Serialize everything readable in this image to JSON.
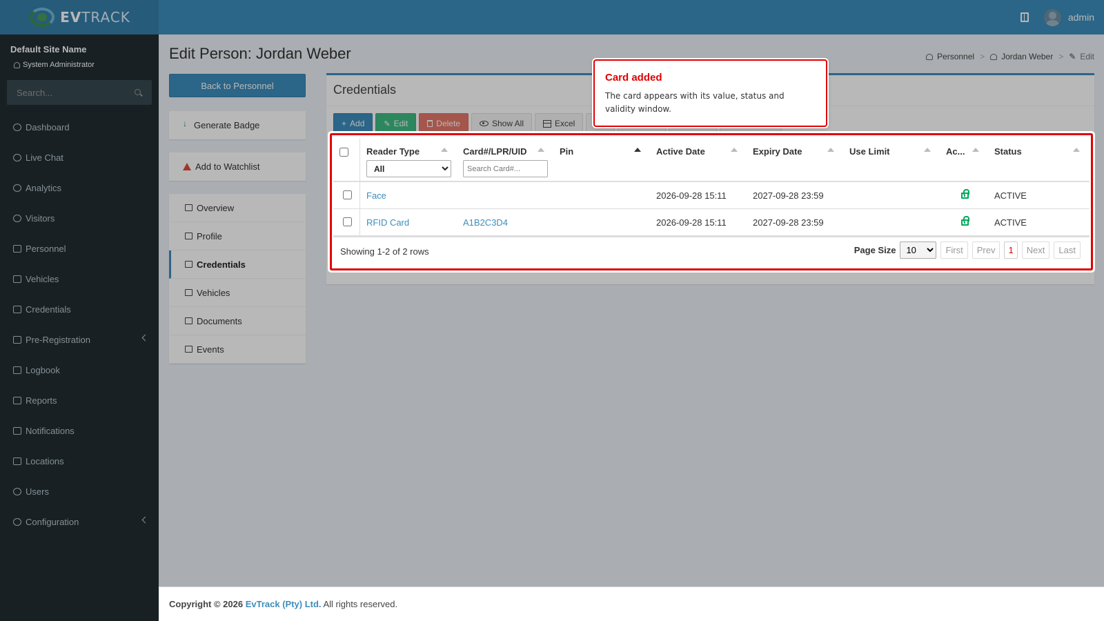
{
  "app": {
    "logo_bold": "EV",
    "logo_light": "TRACK",
    "username": "admin"
  },
  "sidebar": {
    "site_name": "Default Site Name",
    "role": "System Administrator",
    "search_placeholder": "Search...",
    "items": [
      {
        "label": "Dashboard"
      },
      {
        "label": "Live Chat"
      },
      {
        "label": "Analytics"
      },
      {
        "label": "Visitors"
      },
      {
        "label": "Personnel"
      },
      {
        "label": "Vehicles"
      },
      {
        "label": "Credentials"
      },
      {
        "label": "Pre-Registration"
      },
      {
        "label": "Logbook"
      },
      {
        "label": "Reports"
      },
      {
        "label": "Notifications"
      },
      {
        "label": "Locations"
      },
      {
        "label": "Users"
      },
      {
        "label": "Configuration"
      }
    ]
  },
  "page": {
    "title": "Edit Person: Jordan Weber",
    "breadcrumb": [
      "Personnel",
      "Jordan Weber",
      "Edit"
    ],
    "back_button": "Back to Personnel",
    "generate_badge": "Generate Badge",
    "add_watchlist": "Add to Watchlist",
    "tabs": [
      "Overview",
      "Profile",
      "Credentials",
      "Vehicles",
      "Documents",
      "Events"
    ]
  },
  "credentials": {
    "title": "Credentials",
    "toolbar": {
      "add": "Add",
      "edit": "Edit",
      "delete": "Delete",
      "show_all": "Show All",
      "excel": "Excel"
    },
    "columns": [
      "Reader Type",
      "Card#/LPR/UID",
      "Pin",
      "Active Date",
      "Expiry Date",
      "Use Limit",
      "Ac...",
      "Status"
    ],
    "reader_filter_value": "All",
    "card_filter_placeholder": "Search Card#...",
    "rows": [
      {
        "reader_type": "Face",
        "card": "",
        "pin": "",
        "active": "2026-09-28 15:11",
        "expiry": "2027-09-28 23:59",
        "use_limit": "",
        "status": "ACTIVE"
      },
      {
        "reader_type": "RFID Card",
        "card": "A1B2C3D4",
        "pin": "",
        "active": "2026-09-28 15:11",
        "expiry": "2027-09-28 23:59",
        "use_limit": "",
        "status": "ACTIVE"
      }
    ],
    "showing": "Showing 1-2 of 2 rows",
    "page_size_label": "Page Size",
    "page_size": "10",
    "pager": {
      "first": "First",
      "prev": "Prev",
      "current": "1",
      "next": "Next",
      "last": "Last"
    }
  },
  "tooltip": {
    "title": "Card added",
    "body": "The card appears with its value, status and validity window."
  },
  "footer": {
    "prefix": "Copyright © 2026",
    "company": "EvTrack (Pty) Ltd.",
    "suffix": "All rights reserved."
  },
  "colors": {
    "header": "#3c8dbc",
    "sidebar": "#222d32",
    "highlight": "#e00000",
    "active_status": "#00a65a"
  }
}
